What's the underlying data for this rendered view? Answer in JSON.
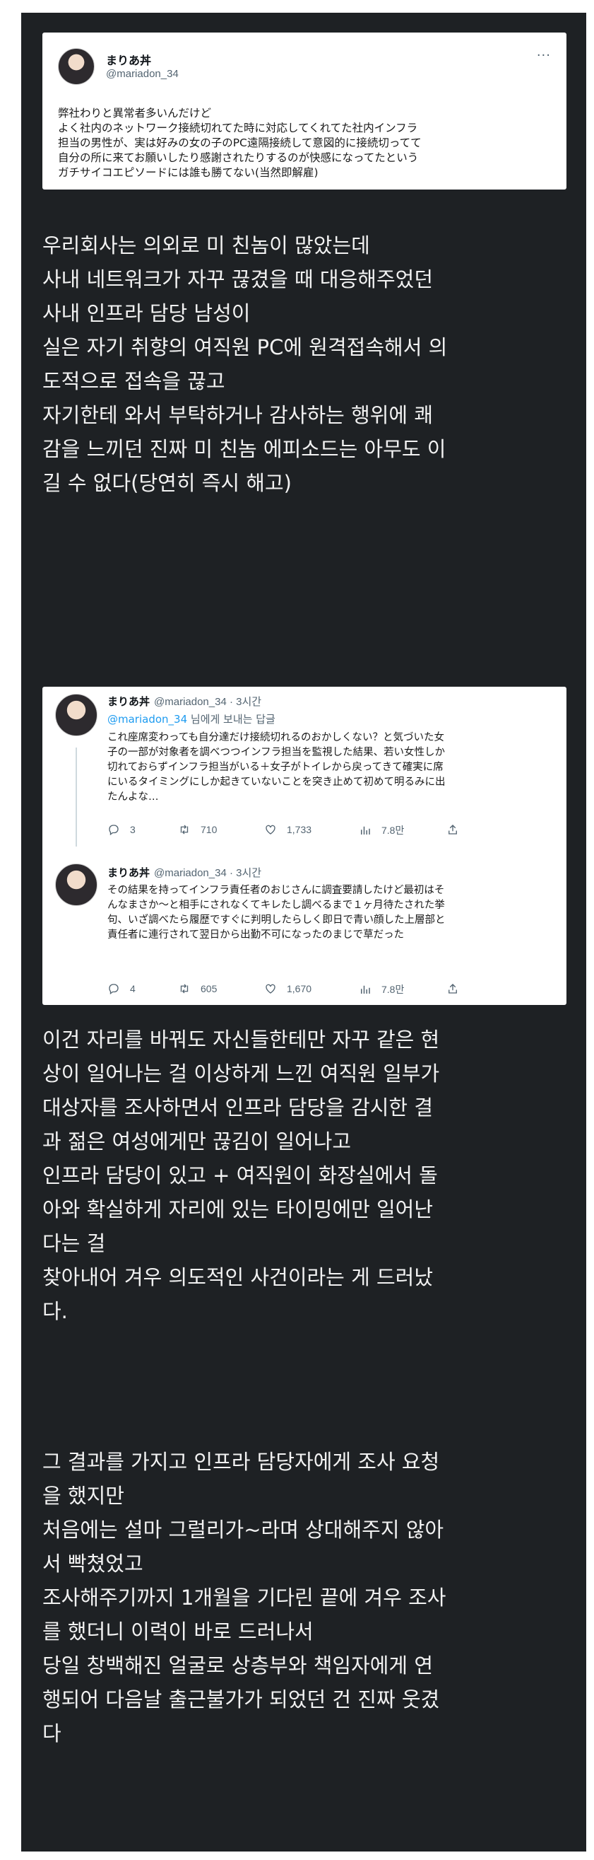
{
  "tweet": {
    "display_name": "まりあ丼",
    "handle": "@mariadon_34",
    "more_label": "···",
    "text": "弊社わりと異常者多いんだけど\nよく社内のネットワーク接続切れてた時に対応してくれてた社内インフラ\n担当の男性が、実は好みの女の子のPC遠隔接続して意図的に接続切ってて\n自分の所に来てお願いしたり感謝されたりするのが快感になってたという\nガチサイコエピソードには誰も勝てない(当然即解雇)"
  },
  "translation_1": "우리회사는 의외로 미 친놈이 많았는데\n사내 네트워크가 자꾸 끊겼을 때 대응해주었던\n사내 인프라 담당 남성이\n실은 자기 취향의 여직원 PC에 원격접속해서 의\n도적으로 접속을 끊고\n자기한테 와서 부탁하거나 감사하는 행위에 쾌\n감을 느끼던 진짜 미 친놈 에피소드는 아무도 이\n길 수 없다(당연히 즉시 해고)",
  "replies": [
    {
      "display_name": "まりあ丼",
      "handle_time": "@mariadon_34 · 3시간",
      "reply_to_mention": "@mariadon_34",
      "reply_to_suffix": " 님에게 보내는 답글",
      "text": "これ座席変わっても自分達だけ接続切れるのおかしくない？と気づいた女\n子の一部が対象者を調べつつインフラ担当を監視した結果、若い女性しか\n切れておらずインフラ担当がいる＋女子がトイレから戻ってきて確実に席\nにいるタイミングにしか起きていないことを突き止めて初めて明るみに出\nたんよな…",
      "replies_count": "3",
      "retweets_count": "710",
      "likes_count": "1,733",
      "views_count": "7.8만"
    },
    {
      "display_name": "まりあ丼",
      "handle_time": "@mariadon_34 · 3시간",
      "text": "その結果を持ってインフラ責任者のおじさんに調査要請したけど最初はそ\nんなまさか〜と相手にされなくてキレたし調べるまで１ヶ月待たされた挙\n句、いざ調べたら履歴ですぐに判明したらしく即日で青い顔した上層部と\n責任者に連行されて翌日から出勤不可になったのまじで草だった",
      "replies_count": "4",
      "retweets_count": "605",
      "likes_count": "1,670",
      "views_count": "7.8만"
    }
  ],
  "translation_2": "이건 자리를 바꿔도 자신들한테만 자꾸 같은 현\n상이 일어나는 걸 이상하게 느낀 여직원 일부가\n대상자를 조사하면서 인프라 담당을 감시한 결\n과 젊은 여성에게만 끊김이 일어나고\n인프라 담당이 있고 + 여직원이 화장실에서 돌\n아와 확실하게 자리에 있는 타이밍에만 일어난\n다는 걸\n찾아내어 겨우 의도적인 사건이라는 게 드러났\n다.",
  "translation_3": "그 결과를 가지고 인프라 담당자에게 조사 요청\n을 했지만\n처음에는 설마 그럴리가~라며 상대해주지 않아\n서 빡쳤었고\n조사해주기까지 1개월을 기다린 끝에 겨우 조사\n를 했더니 이력이 바로 드러나서\n당일 창백해진 얼굴로 상층부와 책임자에게 연\n행되어 다음날 출근불가가 되었던 건 진짜 웃겼\n다",
  "colors": {
    "background": "#1e2124",
    "card": "#ffffff",
    "mention": "#1d9bf0",
    "muted": "#536471"
  },
  "icons": [
    "reply-icon",
    "retweet-icon",
    "like-icon",
    "views-icon",
    "share-icon",
    "more-icon"
  ]
}
